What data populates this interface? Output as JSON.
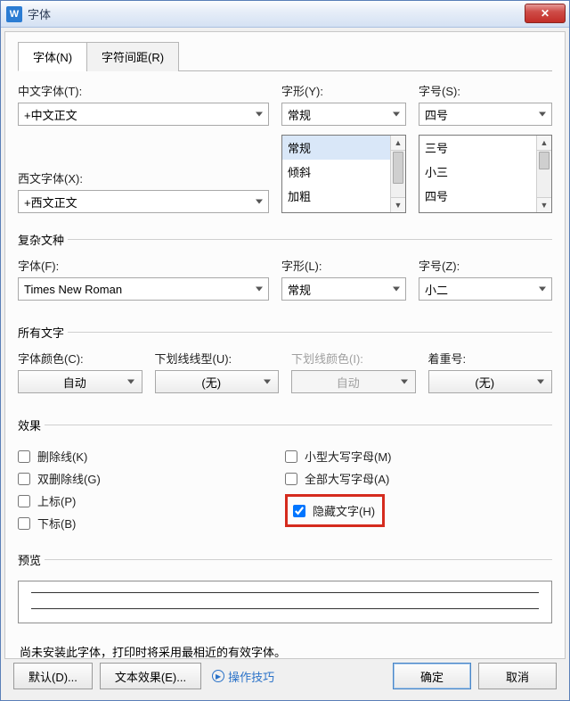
{
  "window": {
    "title": "字体"
  },
  "tabs": {
    "font": "字体(N)",
    "spacing": "字符间距(R)"
  },
  "cn": {
    "cnfont_label": "中文字体(T):",
    "cnfont_value": "+中文正文",
    "style_label": "字形(Y):",
    "style_value": "常规",
    "style_options": [
      "常规",
      "倾斜",
      "加粗"
    ],
    "size_label": "字号(S):",
    "size_value": "四号",
    "size_options": [
      "三号",
      "小三",
      "四号"
    ],
    "westfont_label": "西文字体(X):",
    "westfont_value": "+西文正文"
  },
  "complex": {
    "legend": "复杂文种",
    "font_label": "字体(F):",
    "font_value": "Times New Roman",
    "style_label": "字形(L):",
    "style_value": "常规",
    "size_label": "字号(Z):",
    "size_value": "小二"
  },
  "alltext": {
    "legend": "所有文字",
    "color_label": "字体颜色(C):",
    "color_value": "自动",
    "underline_label": "下划线线型(U):",
    "underline_value": "(无)",
    "underline_color_label": "下划线颜色(I):",
    "underline_color_value": "自动",
    "emphasis_label": "着重号:",
    "emphasis_value": "(无)"
  },
  "effects": {
    "legend": "效果",
    "strike": "删除线(K)",
    "dblstrike": "双删除线(G)",
    "superscript": "上标(P)",
    "subscript": "下标(B)",
    "smallcaps": "小型大写字母(M)",
    "allcaps": "全部大写字母(A)",
    "hidden": "隐藏文字(H)"
  },
  "preview": {
    "legend": "预览"
  },
  "info": "尚未安装此字体，打印时将采用最相近的有效字体。",
  "footer": {
    "default": "默认(D)...",
    "texteffect": "文本效果(E)...",
    "tips": "操作技巧",
    "ok": "确定",
    "cancel": "取消"
  }
}
